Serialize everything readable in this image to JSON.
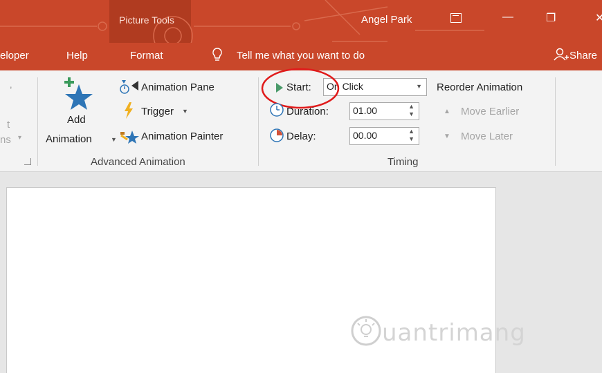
{
  "titlebar": {
    "context_label": "Picture Tools",
    "user_name": "Angel Park",
    "minimize": "—",
    "restore": "❐",
    "close": "✕"
  },
  "tabs": [
    {
      "label": "eloper"
    },
    {
      "label": "Help"
    },
    {
      "label": "Format"
    }
  ],
  "tell_me": "Tell me what you want to do",
  "share": "Share",
  "ribbon": {
    "left_cut_1": "t",
    "left_cut_2": "ns",
    "advanced_animation": {
      "add_animation_line1": "Add",
      "add_animation_line2": "Animation",
      "animation_pane": "Animation Pane",
      "trigger": "Trigger",
      "animation_painter": "Animation Painter",
      "group_label": "Advanced Animation"
    },
    "timing": {
      "start_label": "Start:",
      "start_value": "On Click",
      "duration_label": "Duration:",
      "duration_value": "01.00",
      "delay_label": "Delay:",
      "delay_value": "00.00",
      "reorder_title": "Reorder Animation",
      "move_earlier": "Move Earlier",
      "move_later": "Move Later",
      "group_label": "Timing"
    }
  },
  "watermark": "uantrimang",
  "colors": {
    "brand": "#c9472a",
    "highlight_circle": "#e01b1b",
    "star_blue": "#2e75b6",
    "plus_green": "#3a9a5b"
  }
}
